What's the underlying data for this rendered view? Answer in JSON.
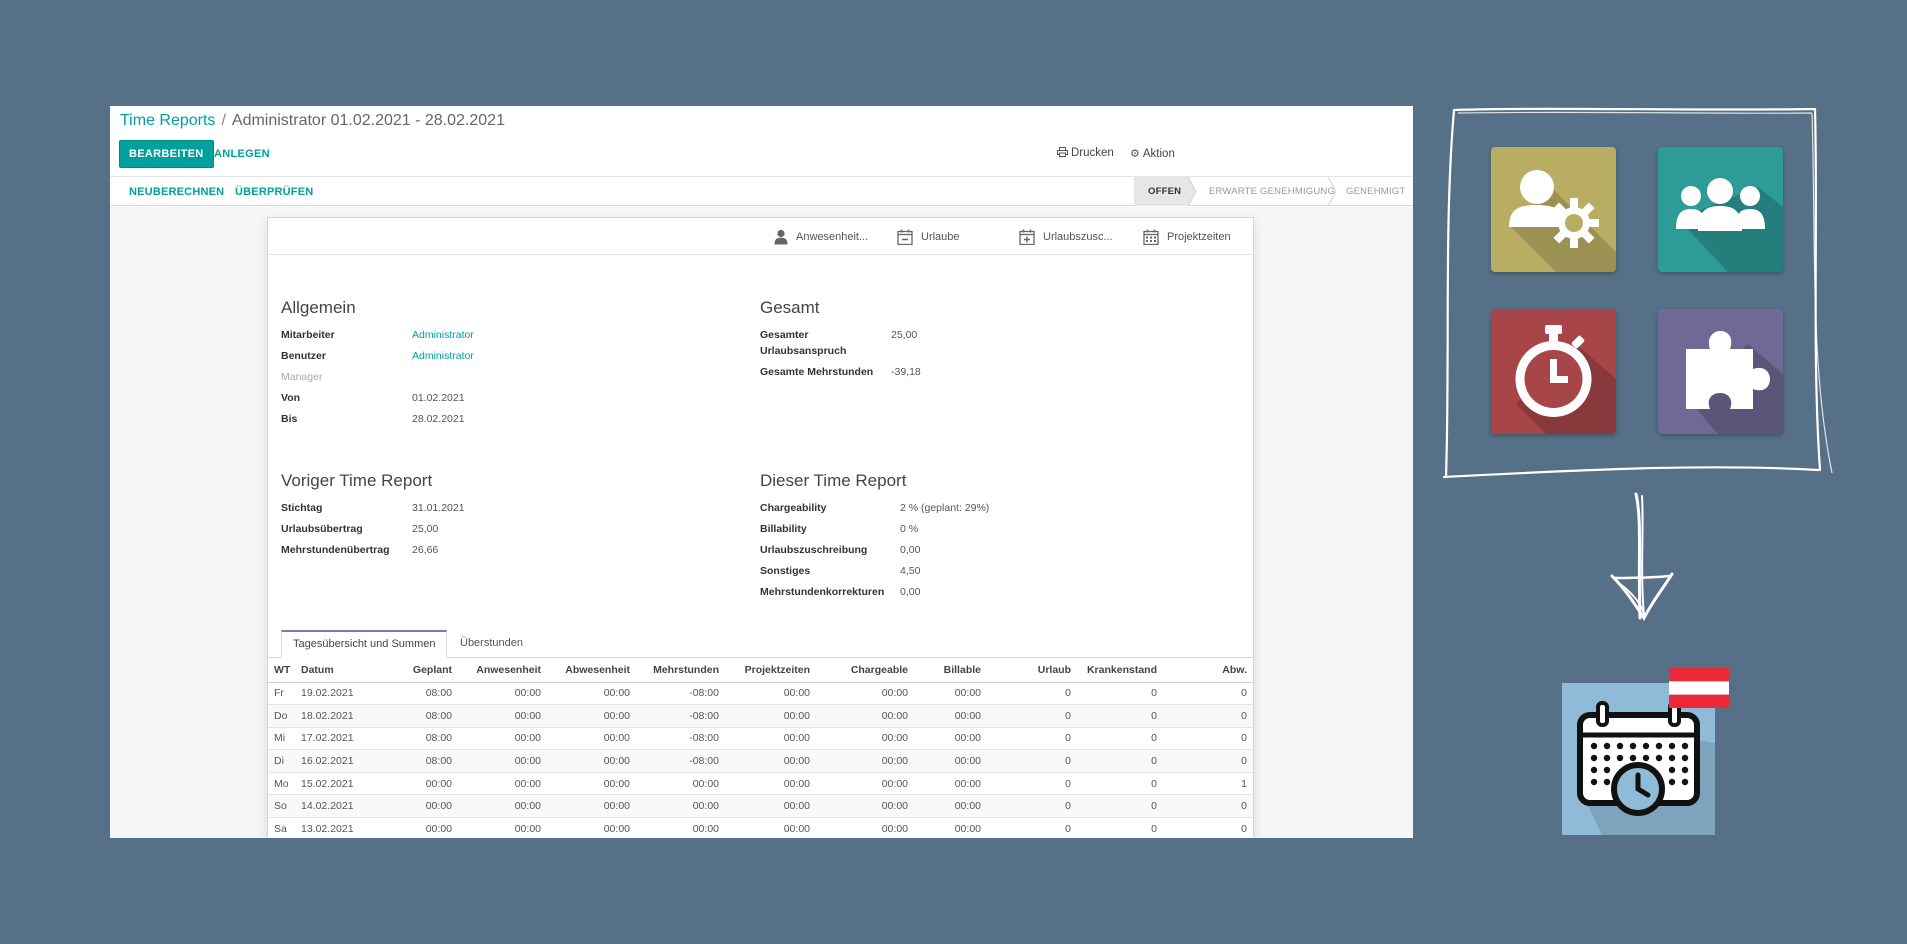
{
  "breadcrumb": {
    "root": "Time Reports",
    "separator": "/",
    "current": "Administrator 01.02.2021 - 28.02.2021"
  },
  "toolbar": {
    "edit_label": "BEARBEITEN",
    "create_label": "ANLEGEN",
    "print_label": "Drucken",
    "action_label": "Aktion"
  },
  "header": {
    "buttons": {
      "recalc": "NEUBERECHNEN",
      "review": "ÜBERPRÜFEN"
    },
    "statuses": [
      "OFFEN",
      "ERWARTE GENEHMIGUNG",
      "GENEHMIGT"
    ],
    "active_status": "OFFEN"
  },
  "smart_buttons": [
    "Anwesenheit...",
    "Urlaube",
    "Urlaubszusc...",
    "Projektzeiten"
  ],
  "general": {
    "title": "Allgemein",
    "employee_label": "Mitarbeiter",
    "employee_value": "Administrator",
    "user_label": "Benutzer",
    "user_value": "Administrator",
    "manager_label": "Manager",
    "from_label": "Von",
    "from_value": "01.02.2021",
    "to_label": "Bis",
    "to_value": "28.02.2021"
  },
  "total": {
    "title": "Gesamt",
    "vacation_label_1": "Gesamter",
    "vacation_label_2": "Urlaubsanspruch",
    "vacation_value": "25,00",
    "overtime_label": "Gesamte Mehrstunden",
    "overtime_value": "-39,18"
  },
  "previous": {
    "title": "Voriger Time Report",
    "date_label": "Stichtag",
    "date_value": "31.01.2021",
    "vac_carry_label": "Urlaubsübertrag",
    "vac_carry_value": "25,00",
    "ot_carry_label": "Mehrstundenübertrag",
    "ot_carry_value": "26,66"
  },
  "current": {
    "title": "Dieser Time Report",
    "chargeability_label": "Chargeability",
    "chargeability_value": "2 % (geplant: 29%)",
    "billability_label": "Billability",
    "billability_value": "0 %",
    "vac_add_label": "Urlaubszuschreibung",
    "vac_add_value": "0,00",
    "other_label": "Sonstiges",
    "other_value": "4,50",
    "ot_corr_label": "Mehrstundenkorrekturen",
    "ot_corr_value": "0,00"
  },
  "tabs": [
    "Tagesübersicht und Summen",
    "Überstunden"
  ],
  "table": {
    "columns": [
      "WT",
      "Datum",
      "Geplant",
      "Anwesenheit",
      "Abwesenheit",
      "Mehrstunden",
      "Projektzeiten",
      "Chargeable",
      "Billable",
      "Urlaub",
      "Krankenstand",
      "Abw."
    ],
    "rows": [
      [
        "Fr",
        "19.02.2021",
        "08:00",
        "00:00",
        "00:00",
        "-08:00",
        "00:00",
        "00:00",
        "00:00",
        "0",
        "0",
        "0"
      ],
      [
        "Do",
        "18.02.2021",
        "08:00",
        "00:00",
        "00:00",
        "-08:00",
        "00:00",
        "00:00",
        "00:00",
        "0",
        "0",
        "0"
      ],
      [
        "Mi",
        "17.02.2021",
        "08:00",
        "00:00",
        "00:00",
        "-08:00",
        "00:00",
        "00:00",
        "00:00",
        "0",
        "0",
        "0"
      ],
      [
        "Di",
        "16.02.2021",
        "08:00",
        "00:00",
        "00:00",
        "-08:00",
        "00:00",
        "00:00",
        "00:00",
        "0",
        "0",
        "0"
      ],
      [
        "Mo",
        "15.02.2021",
        "00:00",
        "00:00",
        "00:00",
        "00:00",
        "00:00",
        "00:00",
        "00:00",
        "0",
        "0",
        "1"
      ],
      [
        "So",
        "14.02.2021",
        "00:00",
        "00:00",
        "00:00",
        "00:00",
        "00:00",
        "00:00",
        "00:00",
        "0",
        "0",
        "0"
      ],
      [
        "Sa",
        "13.02.2021",
        "00:00",
        "00:00",
        "00:00",
        "00:00",
        "00:00",
        "00:00",
        "00:00",
        "0",
        "0",
        "0"
      ]
    ]
  },
  "app_icons": [
    {
      "icon": "user-gear-icon",
      "color": "#b8ad63"
    },
    {
      "icon": "users-icon",
      "color": "#2d9b98"
    },
    {
      "icon": "stopwatch-icon",
      "color": "#a84548"
    },
    {
      "icon": "puzzle-icon",
      "color": "#6e6a95"
    }
  ],
  "colors": {
    "background": "#567087",
    "accent": "#00a09d",
    "calendar_tile": "#8fbad8",
    "flag_red": "#ed2939"
  }
}
